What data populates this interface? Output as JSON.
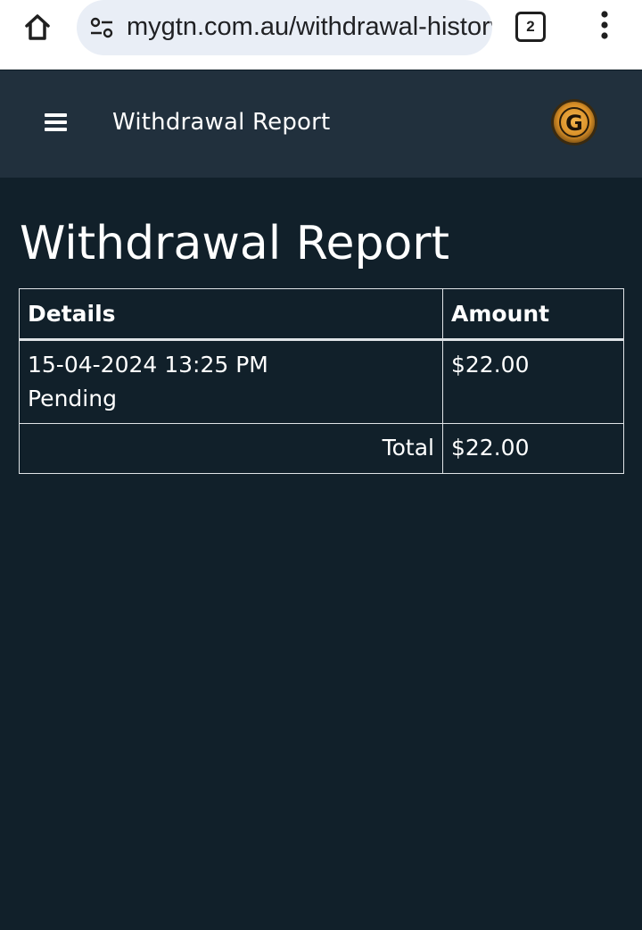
{
  "browser": {
    "url": "mygtn.com.au/withdrawal-history",
    "tab_count": "2"
  },
  "header": {
    "title": "Withdrawal Report",
    "logo_letter": "G"
  },
  "page": {
    "title": "Withdrawal Report"
  },
  "table": {
    "columns": [
      "Details",
      "Amount"
    ],
    "rows": [
      {
        "date": "15-04-2024 13:25 PM",
        "status": "Pending",
        "amount": "$22.00"
      }
    ],
    "total_label": "Total",
    "total_amount": "$22.00"
  },
  "colors": {
    "page_bg": "#11202a",
    "header_bg": "#21303d",
    "logo_gold": "#e0a43a"
  }
}
